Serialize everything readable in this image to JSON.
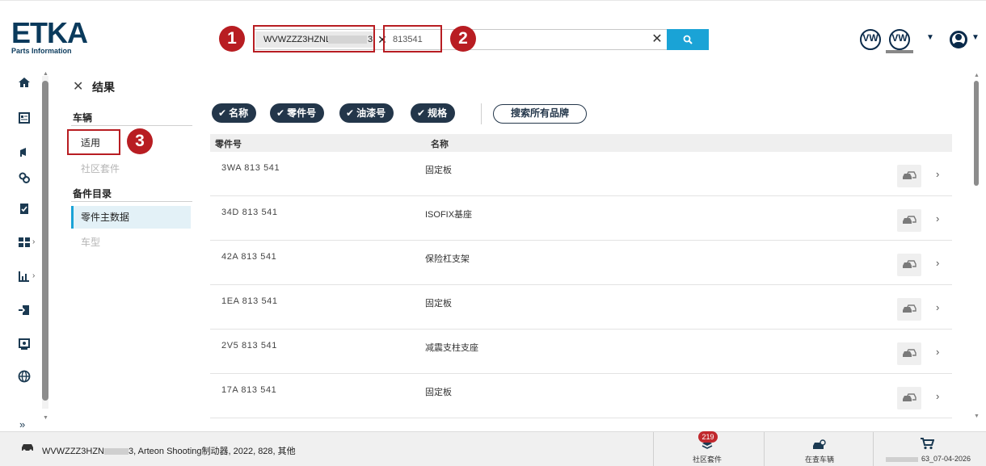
{
  "brand": {
    "name": "ETKA",
    "subtitle": "Parts Information"
  },
  "search": {
    "vin_chip_visible": "WVWZZZ3HZNL",
    "vin_chip_tail": "3",
    "chip_remove": "✕",
    "query": "813541",
    "clear": "✕"
  },
  "callouts": {
    "one": "1",
    "two": "2",
    "three": "3"
  },
  "header": {
    "brand_logo_1": "VW",
    "brand_logo_2": "VW"
  },
  "filter_panel": {
    "close": "✕",
    "title": "结果",
    "vehicle_group": "车辆",
    "vehicle_items": [
      "适用",
      "社区套件"
    ],
    "catalog_group": "备件目录",
    "catalog_items": [
      "零件主数据",
      "车型"
    ]
  },
  "filters": {
    "chips": [
      "名称",
      "零件号",
      "油漆号",
      "规格"
    ],
    "search_all_brands": "搜索所有品牌"
  },
  "table": {
    "columns": [
      "零件号",
      "名称"
    ],
    "rows": [
      {
        "part_no": "3WA 813 541",
        "name": "固定板"
      },
      {
        "part_no": "34D 813 541",
        "name": "ISOFIX基座"
      },
      {
        "part_no": "42A 813 541",
        "name": "保险杠支架"
      },
      {
        "part_no": "1EA 813 541",
        "name": "固定板"
      },
      {
        "part_no": "2V5 813 541",
        "name": "减震支柱支座"
      },
      {
        "part_no": "17A 813 541",
        "name": "固定板"
      }
    ]
  },
  "footer": {
    "vehicle_prefix": "WVWZZZ3HZN",
    "vehicle_suffix": "3, Arteon Shooting制动器, 2022, 828, 其他",
    "kits_label": "社区套件",
    "kits_count": "219",
    "vehicles_label": "在查车辆",
    "cart_label": "63_07-04-2026"
  },
  "colors": {
    "accent": "#1aa3d6",
    "navy": "#23364a",
    "callout": "#b81d22"
  }
}
